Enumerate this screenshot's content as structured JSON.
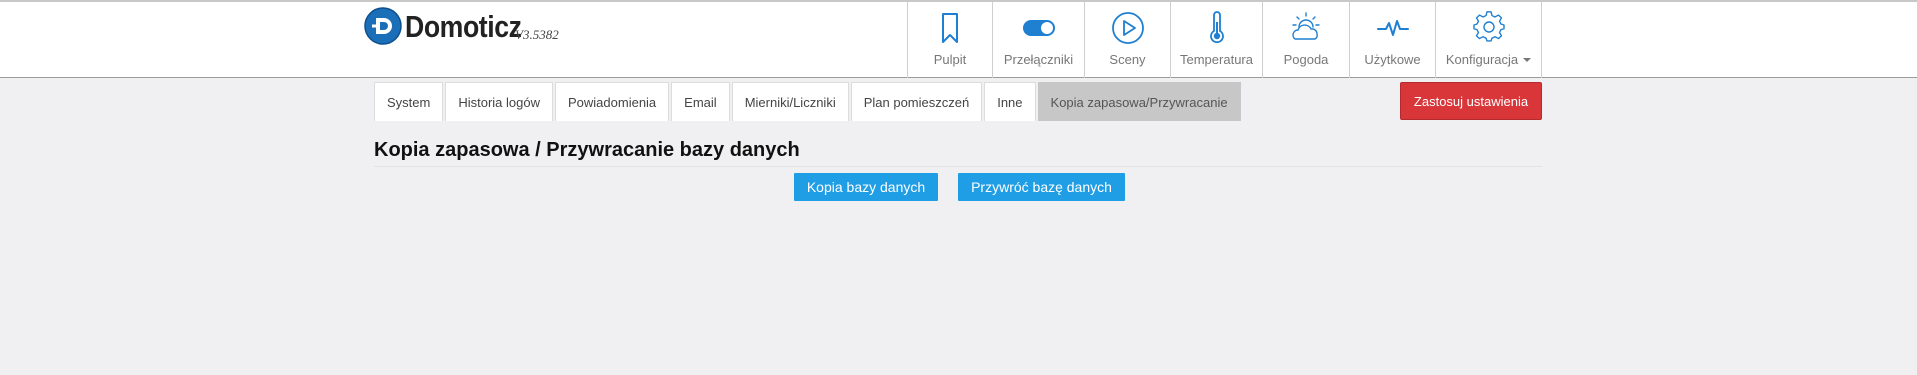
{
  "brand": {
    "name": "Domoticz",
    "version": "V3.5382"
  },
  "nav": {
    "items": [
      {
        "label": "Pulpit",
        "icon": "bookmark-icon"
      },
      {
        "label": "Przełączniki",
        "icon": "toggle-switch-icon"
      },
      {
        "label": "Sceny",
        "icon": "play-circle-icon"
      },
      {
        "label": "Temperatura",
        "icon": "thermometer-icon"
      },
      {
        "label": "Pogoda",
        "icon": "weather-sun-cloud-icon"
      },
      {
        "label": "Użytkowe",
        "icon": "pulse-icon"
      },
      {
        "label": "Konfiguracja",
        "icon": "gear-icon"
      }
    ]
  },
  "tabs": [
    {
      "label": "System"
    },
    {
      "label": "Historia logów"
    },
    {
      "label": "Powiadomienia"
    },
    {
      "label": "Email"
    },
    {
      "label": "Mierniki/Liczniki"
    },
    {
      "label": "Plan pomieszczeń"
    },
    {
      "label": "Inne"
    },
    {
      "label": "Kopia zapasowa/Przywracanie",
      "active": true
    }
  ],
  "apply_button": "Zastosuj ustawienia",
  "page": {
    "title": "Kopia zapasowa / Przywracanie bazy danych",
    "backup_button": "Kopia bazy danych",
    "restore_button": "Przywróć bazę danych"
  },
  "colors": {
    "accent": "#1f9ee6",
    "danger": "#d9363a",
    "icon": "#1f7fd1",
    "background": "#f0f0f2"
  }
}
